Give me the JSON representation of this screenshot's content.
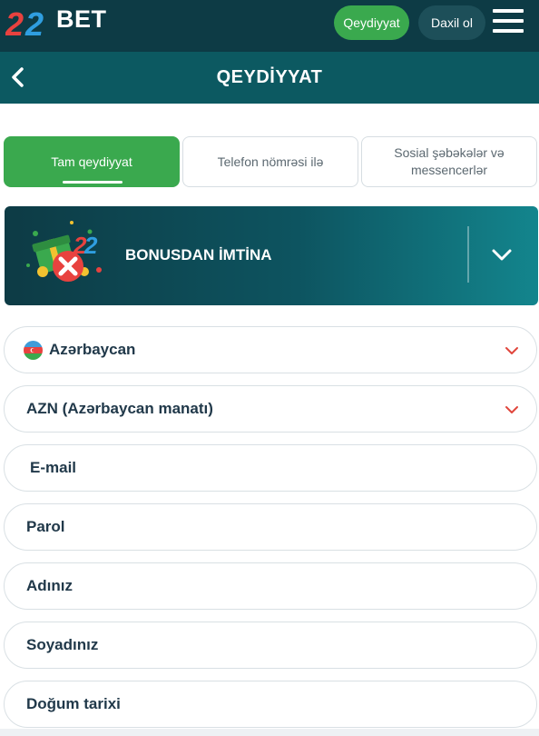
{
  "header": {
    "logo_digits": "22",
    "logo_text": "BET",
    "register_label": "Qeydiyyat",
    "login_label": "Daxil ol",
    "menu_icon": "hamburger-icon"
  },
  "page": {
    "title": "QEYDİYYAT",
    "back_icon": "chevron-left-icon"
  },
  "tabs": [
    {
      "label": "Tam qeydiyyat",
      "active": true
    },
    {
      "label": "Telefon nömrəsi ilə",
      "active": false
    },
    {
      "label": "Sosial şəbəkələr və messencerlər",
      "active": false
    }
  ],
  "bonus": {
    "label": "BONUSDAN İMTİNA",
    "chevron_icon": "chevron-down-icon"
  },
  "form": {
    "country": "Azərbaycan",
    "currency": "AZN (Azərbaycan manatı)",
    "email_placeholder": "E-mail",
    "password_placeholder": "Parol",
    "firstname_placeholder": "Adınız",
    "lastname_placeholder": "Soyadınız",
    "birthdate_placeholder": "Doğum tarixi"
  },
  "colors": {
    "topbar": "#0d3b45",
    "titlebar": "#0c5961",
    "accent_green": "#3aa94e",
    "chevron_red": "#e0463c",
    "field_text": "#21394a"
  }
}
